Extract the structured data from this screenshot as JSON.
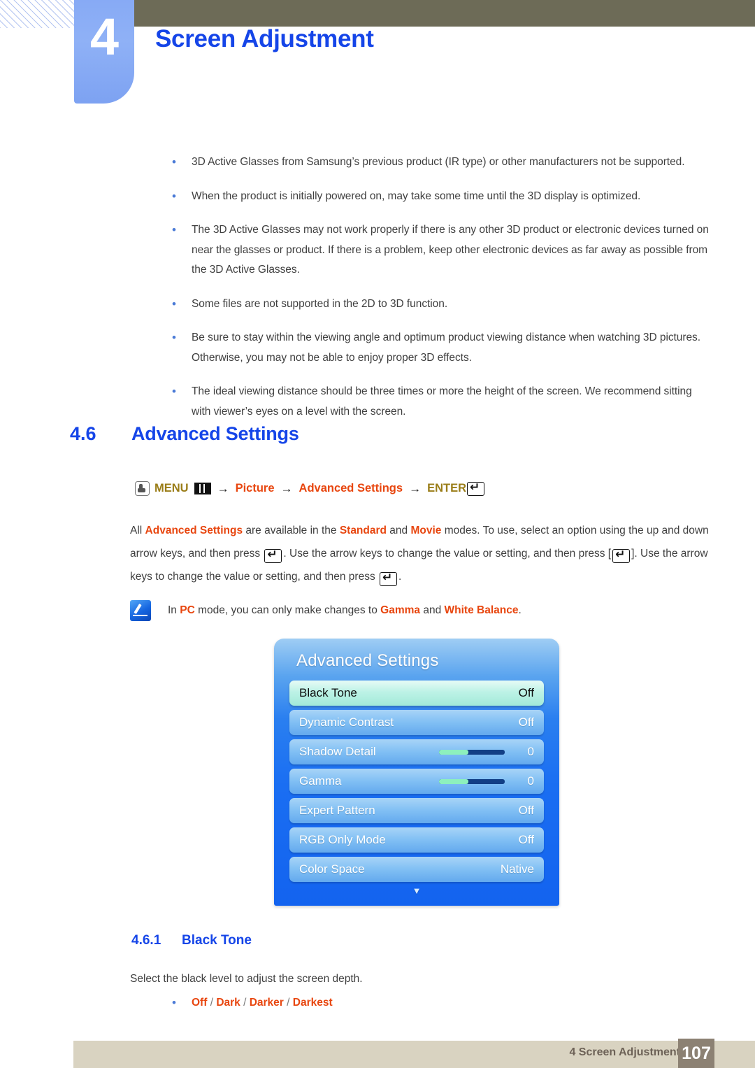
{
  "header": {
    "chapter_number": "4",
    "chapter_title": "Screen Adjustment"
  },
  "notes_bullets": [
    "3D Active Glasses from Samsung’s previous product (IR type) or other manufacturers not be supported.",
    "When the product is initially powered on, may take some time until the 3D display is optimized.",
    "The 3D Active Glasses may not work properly if there is any other 3D product or electronic devices turned on near the glasses or product. If there is a problem, keep other electronic devices as far away as possible from the 3D Active Glasses.",
    "Some files are not supported in the 2D to 3D function.",
    "Be sure to stay within the viewing angle and optimum product viewing distance when watching 3D pictures. Otherwise, you may not be able to enjoy proper 3D effects.",
    "The ideal viewing distance should be three times or more the height of the screen. We recommend sitting with viewer’s eyes on a level with the screen."
  ],
  "section": {
    "number": "4.6",
    "title": "Advanced Settings"
  },
  "menu_path": {
    "menu_label": "MENU",
    "arrow": "→",
    "item1": "Picture",
    "item2": "Advanced Settings",
    "enter_label": "ENTER"
  },
  "paragraph": {
    "p1_a": "All ",
    "p1_b": "Advanced Settings",
    "p1_c": " are available in the ",
    "p1_d": "Standard",
    "p1_e": " and ",
    "p1_f": "Movie",
    "p1_g": " modes. To use, select an option using the up and down arrow keys, and then press ",
    "p1_h": ". Use the arrow keys to change the value or setting, and then press [",
    "p1_i": "]. Use the arrow keys to change the value or setting, and then press ",
    "p1_j": "."
  },
  "note": {
    "a": "In ",
    "b": "PC",
    "c": " mode, you can only make changes to ",
    "d": "Gamma",
    "e": " and ",
    "f": "White Balance",
    "g": "."
  },
  "osd": {
    "title": "Advanced Settings",
    "more_indicator": "▼",
    "rows": [
      {
        "label": "Black Tone",
        "value": "Off",
        "selected": true,
        "slider": null
      },
      {
        "label": "Dynamic Contrast",
        "value": "Off",
        "selected": false,
        "slider": null
      },
      {
        "label": "Shadow Detail",
        "value": "0",
        "selected": false,
        "slider": 45
      },
      {
        "label": "Gamma",
        "value": "0",
        "selected": false,
        "slider": 45
      },
      {
        "label": "Expert Pattern",
        "value": "Off",
        "selected": false,
        "slider": null
      },
      {
        "label": "RGB Only Mode",
        "value": "Off",
        "selected": false,
        "slider": null
      },
      {
        "label": "Color Space",
        "value": "Native",
        "selected": false,
        "slider": null
      }
    ]
  },
  "subsection": {
    "number": "4.6.1",
    "title": "Black Tone",
    "description": "Select the black level to adjust the screen depth.",
    "options": [
      "Off",
      "Dark",
      "Darker",
      "Darkest"
    ]
  },
  "footer": {
    "label": "4 Screen Adjustment",
    "page": "107"
  },
  "colors": {
    "accent_blue": "#1545e8",
    "accent_orange": "#e8460f",
    "olive": "#6d6b57",
    "tab_blue": "#8fb1f6",
    "footer_beige": "#d9d3c1",
    "footer_brown": "#8c8173",
    "menu_olive_text": "#9a7d18"
  }
}
